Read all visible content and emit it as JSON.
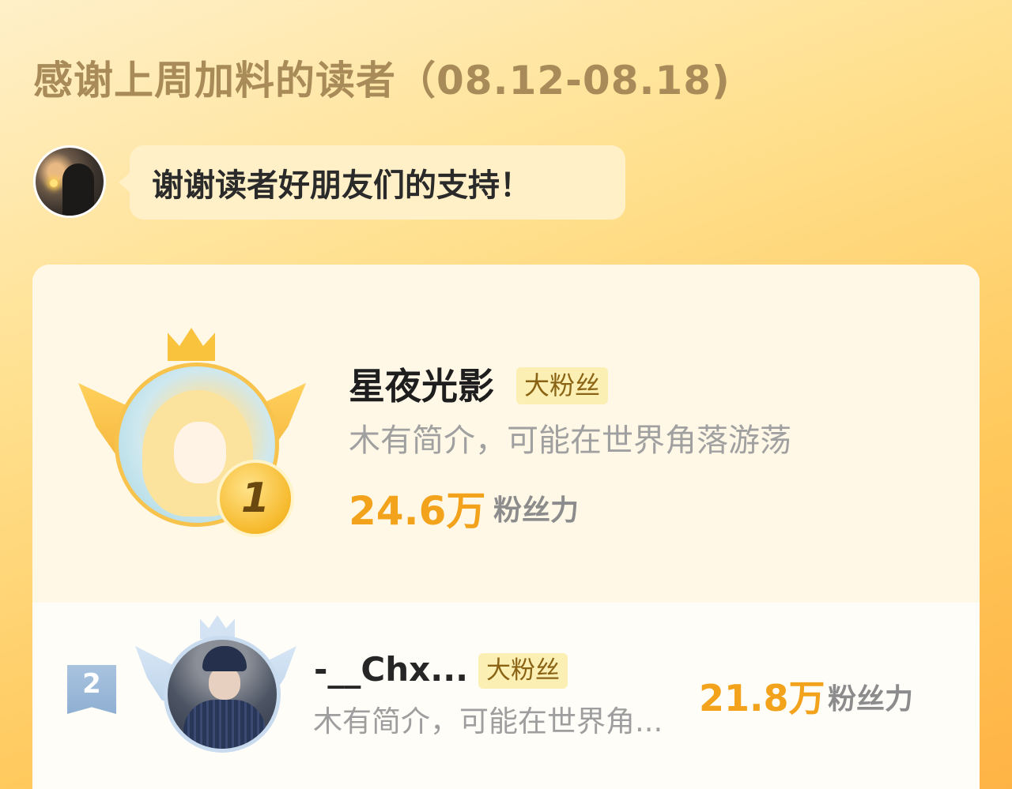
{
  "header": {
    "title": "感谢上周加料的读者（08.12-08.18)"
  },
  "host": {
    "message": "谢谢读者好朋友们的支持！"
  },
  "leaderboard": {
    "entries": [
      {
        "rank": "1",
        "name": "星夜光影",
        "tag": "大粉丝",
        "bio": "木有简介，可能在世界角落游荡",
        "score": "24.6万",
        "score_label": "粉丝力"
      },
      {
        "rank": "2",
        "name": "-__Chx...",
        "tag": "大粉丝",
        "bio": "木有简介，可能在世界角...",
        "score": "21.8万",
        "score_label": "粉丝力"
      }
    ]
  },
  "icons": {
    "rank1": "gold-crown-wings-icon",
    "rank2": "silver-crown-wings-icon",
    "rank2_flag": "rank-ribbon-icon"
  },
  "colors": {
    "accent": "#f2a31b",
    "title": "#a88b58",
    "tag_bg": "#fcefb3",
    "tag_text": "#8a6414"
  }
}
